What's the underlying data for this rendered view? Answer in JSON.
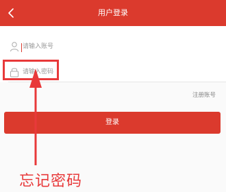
{
  "header": {
    "title": "用户登录",
    "background": "#db3a2d"
  },
  "form": {
    "phone": {
      "placeholder": "请输入账号",
      "icon": "user-icon"
    },
    "password": {
      "placeholder": "请输入密码",
      "icon": "lock-icon"
    }
  },
  "links": {
    "register": "注册账号"
  },
  "login_button": {
    "label": "登录"
  },
  "annotation": {
    "text": "忘记密码",
    "color": "#e8393a"
  }
}
